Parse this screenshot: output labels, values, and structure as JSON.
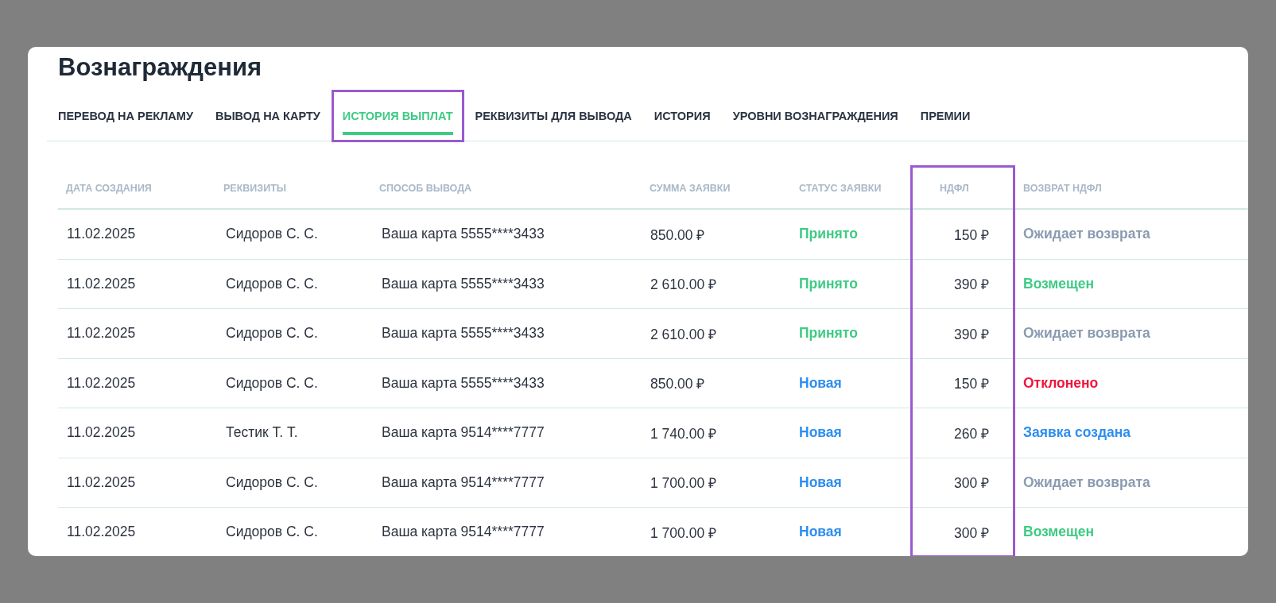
{
  "page": {
    "title": "Вознаграждения"
  },
  "tabs": [
    {
      "label": "ПЕРЕВОД НА РЕКЛАМУ",
      "selected": false,
      "highlighted": false
    },
    {
      "label": "ВЫВОД НА КАРТУ",
      "selected": false,
      "highlighted": false
    },
    {
      "label": "ИСТОРИЯ ВЫПЛАТ",
      "selected": true,
      "highlighted": true
    },
    {
      "label": "РЕКВИЗИТЫ ДЛЯ ВЫВОДА",
      "selected": false,
      "highlighted": false
    },
    {
      "label": "ИСТОРИЯ",
      "selected": false,
      "highlighted": false
    },
    {
      "label": "УРОВНИ ВОЗНАГРАЖДЕНИЯ",
      "selected": false,
      "highlighted": false
    },
    {
      "label": "ПРЕМИИ",
      "selected": false,
      "highlighted": false
    }
  ],
  "table": {
    "columns": [
      {
        "label": "ДАТА СОЗДАНИЯ",
        "highlighted": false
      },
      {
        "label": "РЕКВИЗИТЫ",
        "highlighted": false
      },
      {
        "label": "СПОСОБ ВЫВОДА",
        "highlighted": false
      },
      {
        "label": "СУММА ЗАЯВКИ",
        "highlighted": false
      },
      {
        "label": "СТАТУС ЗАЯВКИ",
        "highlighted": false
      },
      {
        "label": "НДФЛ",
        "highlighted": true
      },
      {
        "label": "ВОЗВРАТ НДФЛ",
        "highlighted": false
      }
    ],
    "rows": [
      {
        "date": "11.02.2025",
        "requisites": "Сидоров С. С.",
        "method": "Ваша карта 5555****3433",
        "amount": "850.00 ₽",
        "status": {
          "text": "Принято",
          "kind": "accepted"
        },
        "tax": "150 ₽",
        "refund": {
          "text": "Ожидает возврата",
          "kind": "pending"
        }
      },
      {
        "date": "11.02.2025",
        "requisites": "Сидоров С. С.",
        "method": "Ваша карта 5555****3433",
        "amount": "2 610.00 ₽",
        "status": {
          "text": "Принято",
          "kind": "accepted"
        },
        "tax": "390 ₽",
        "refund": {
          "text": "Возмещен",
          "kind": "accepted"
        }
      },
      {
        "date": "11.02.2025",
        "requisites": "Сидоров С. С.",
        "method": "Ваша карта 5555****3433",
        "amount": "2 610.00 ₽",
        "status": {
          "text": "Принято",
          "kind": "accepted"
        },
        "tax": "390 ₽",
        "refund": {
          "text": "Ожидает возврата",
          "kind": "pending"
        }
      },
      {
        "date": "11.02.2025",
        "requisites": "Сидоров С. С.",
        "method": "Ваша карта 5555****3433",
        "amount": "850.00 ₽",
        "status": {
          "text": "Новая",
          "kind": "new"
        },
        "tax": "150 ₽",
        "refund": {
          "text": "Отклонено",
          "kind": "rejected"
        }
      },
      {
        "date": "11.02.2025",
        "requisites": "Тестик Т. Т.",
        "method": "Ваша карта 9514****7777",
        "amount": "1 740.00 ₽",
        "status": {
          "text": "Новая",
          "kind": "new"
        },
        "tax": "260 ₽",
        "refund": {
          "text": "Заявка создана",
          "kind": "new"
        }
      },
      {
        "date": "11.02.2025",
        "requisites": "Сидоров С. С.",
        "method": "Ваша карта 9514****7777",
        "amount": "1 700.00 ₽",
        "status": {
          "text": "Новая",
          "kind": "new"
        },
        "tax": "300 ₽",
        "refund": {
          "text": "Ожидает возврата",
          "kind": "pending"
        }
      },
      {
        "date": "11.02.2025",
        "requisites": "Сидоров С. С.",
        "method": "Ваша карта 9514****7777",
        "amount": "1 700.00 ₽",
        "status": {
          "text": "Новая",
          "kind": "new"
        },
        "tax": "300 ₽",
        "refund": {
          "text": "Возмещен",
          "kind": "accepted"
        }
      }
    ]
  }
}
